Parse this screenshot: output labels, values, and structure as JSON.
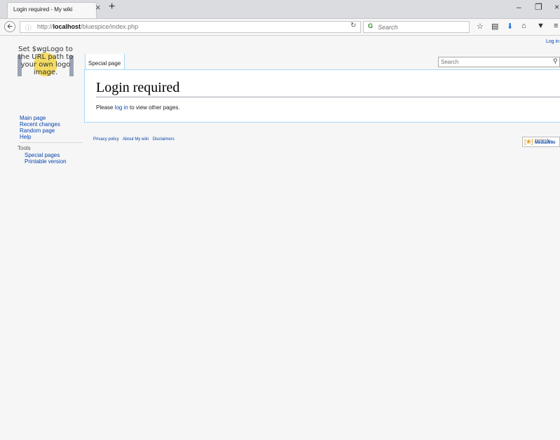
{
  "browser": {
    "tab_title": "Login required - My wiki",
    "tab_close": "×",
    "new_tab": "+",
    "url_prefix": "http://",
    "url_host": "localhost",
    "url_path": "/bluespice/index.php",
    "search_placeholder": "Search",
    "icons": {
      "back": "back-arrow-icon",
      "info": "info-icon",
      "reload": "reload-icon",
      "bookmark": "star-icon",
      "reader": "reading-list-icon",
      "download": "download-icon",
      "home": "home-icon",
      "pocket": "pocket-icon",
      "menu": "hamburger-menu-icon"
    }
  },
  "wiki": {
    "logo_text": "Set $wgLogo to the URL path to your own logo image.",
    "login_link": "Log in",
    "tab_special_page": "Special page",
    "search_placeholder": "Search",
    "heading": "Login required",
    "body_before": "Please ",
    "body_link": "log in",
    "body_after": " to view other pages.",
    "sidebar": {
      "navigation": [
        {
          "label": "Main page"
        },
        {
          "label": "Recent changes"
        },
        {
          "label": "Random page"
        },
        {
          "label": "Help"
        }
      ],
      "tools_label": "Tools",
      "tools": [
        {
          "label": "Special pages"
        },
        {
          "label": "Printable version"
        }
      ]
    },
    "footer": [
      {
        "label": "Privacy policy"
      },
      {
        "label": "About My wiki"
      },
      {
        "label": "Disclaimers"
      }
    ],
    "powered_by": {
      "line1": "Powered By",
      "line2": "MediaWiki"
    }
  },
  "colors": {
    "link": "#0645ad",
    "content_border": "#a7d7f9",
    "page_background": "#f6f6f6"
  }
}
